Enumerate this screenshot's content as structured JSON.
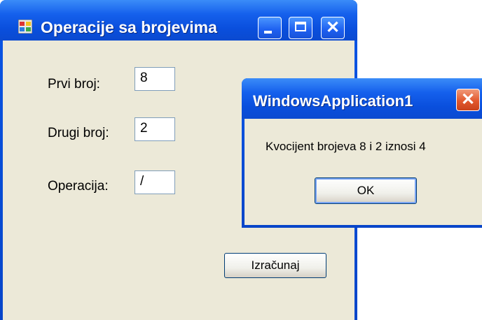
{
  "main_window": {
    "title": "Operacije sa brojevima",
    "fields": [
      {
        "label": "Prvi broj:",
        "value": "8"
      },
      {
        "label": "Drugi broj:",
        "value": "2"
      },
      {
        "label": "Operacija:",
        "value": "/"
      }
    ],
    "calculate_button": "Izračunaj"
  },
  "message_box": {
    "title": "WindowsApplication1",
    "message": "Kvocijent brojeva 8 i 2 iznosi 4",
    "ok_button": "OK"
  },
  "icons": {
    "app": "app-window-icon",
    "minimize": "minimize-icon",
    "maximize": "maximize-icon",
    "close": "close-icon"
  },
  "colors": {
    "titlebar": "#0a4fdd",
    "client_background": "#ece9d8",
    "close_button": "#e2582d"
  }
}
